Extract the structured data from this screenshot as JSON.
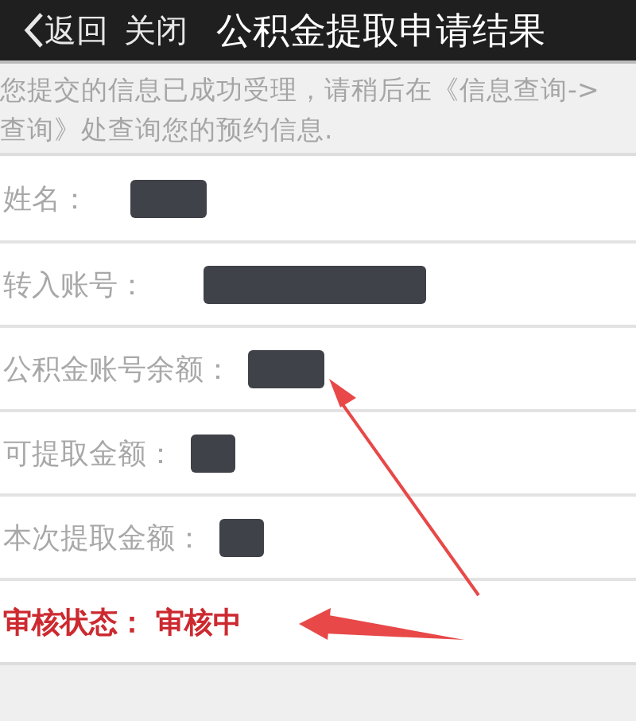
{
  "header": {
    "back": "返回",
    "close": "关闭",
    "title": "公积金提取申请结果"
  },
  "notice": {
    "lines": [
      "您提交的信息已成功受理，请稍后在《信息查询->",
      "查询》处查询您的预约信息."
    ]
  },
  "rows": [
    {
      "kind": "redacted",
      "label": "姓名："
    },
    {
      "kind": "redacted",
      "label": "转入账号："
    },
    {
      "kind": "redacted",
      "label": "公积金账号余额："
    },
    {
      "kind": "redacted",
      "label": "可提取金额："
    },
    {
      "kind": "redacted",
      "label": "本次提取金额："
    },
    {
      "kind": "status",
      "label": "审核状态：",
      "value": "审核中"
    }
  ]
}
